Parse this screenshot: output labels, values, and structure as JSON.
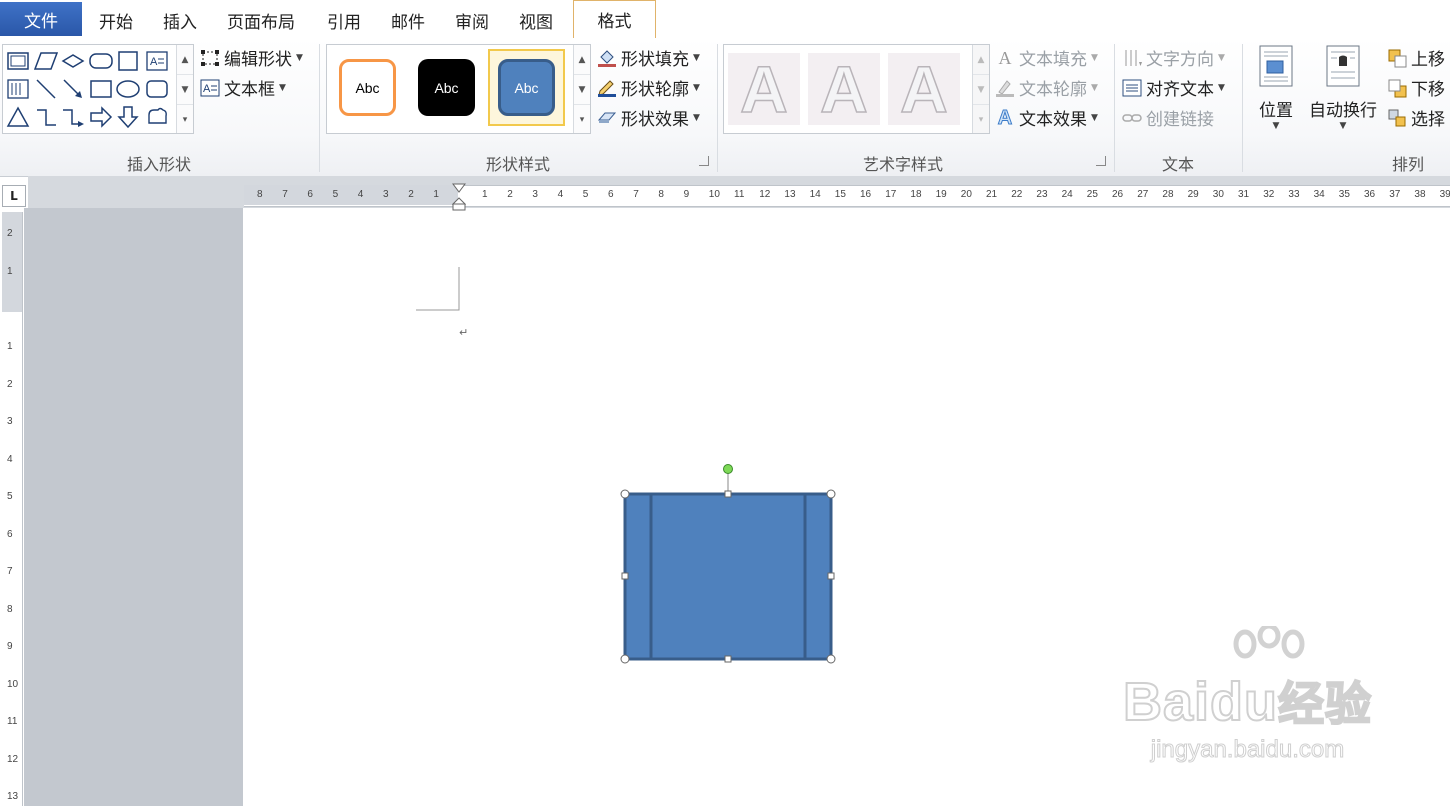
{
  "tabs": {
    "file": "文件",
    "home": "开始",
    "insert": "插入",
    "layout": "页面布局",
    "references": "引用",
    "mailings": "邮件",
    "review": "审阅",
    "view": "视图",
    "format": "格式"
  },
  "ribbon": {
    "insert_shapes": {
      "label": "插入形状",
      "edit_shape": "编辑形状",
      "text_box": "文本框"
    },
    "shape_styles": {
      "label": "形状样式",
      "swatch_text": "Abc",
      "fill": "形状填充",
      "outline": "形状轮廓",
      "effects": "形状效果",
      "swatch_colors": [
        "#f79646",
        "#000000",
        "#4f81bd"
      ]
    },
    "wordart_styles": {
      "label": "艺术字样式",
      "letter": "A",
      "text_fill": "文本填充",
      "text_outline": "文本轮廓",
      "text_effects": "文本效果"
    },
    "text": {
      "label": "文本",
      "direction": "文字方向",
      "align": "对齐文本",
      "link": "创建链接"
    },
    "arrange": {
      "label": "排列",
      "position": "位置",
      "wrap": "自动换行",
      "bring_forward": "上移",
      "send_backward": "下移",
      "selection_pane": "选择"
    }
  },
  "ruler": {
    "corner": "L",
    "h_left": [
      "8",
      "7",
      "6",
      "5",
      "4",
      "3",
      "2",
      "1"
    ],
    "h_right": [
      "1",
      "2",
      "3",
      "4",
      "5",
      "6",
      "7",
      "8",
      "9",
      "10",
      "11",
      "12",
      "13",
      "14",
      "15",
      "16",
      "17",
      "18",
      "19",
      "20",
      "21",
      "22",
      "23",
      "24",
      "25",
      "26",
      "27",
      "28",
      "29",
      "30",
      "31",
      "32",
      "33",
      "34",
      "35",
      "36",
      "37",
      "38",
      "39"
    ],
    "v_top": [
      "2",
      "1"
    ],
    "v_bottom": [
      "1",
      "2",
      "3",
      "4",
      "5",
      "6",
      "7",
      "8",
      "9",
      "10",
      "11",
      "12",
      "13"
    ]
  },
  "document": {
    "paragraph_mark": "↵",
    "shape_fill": "#4f81bd",
    "shape_border": "#385d8a"
  },
  "watermark": {
    "brand": "Bai",
    "brand2": "du",
    "brand_cn": "经验",
    "url": "jingyan.baidu.com"
  }
}
